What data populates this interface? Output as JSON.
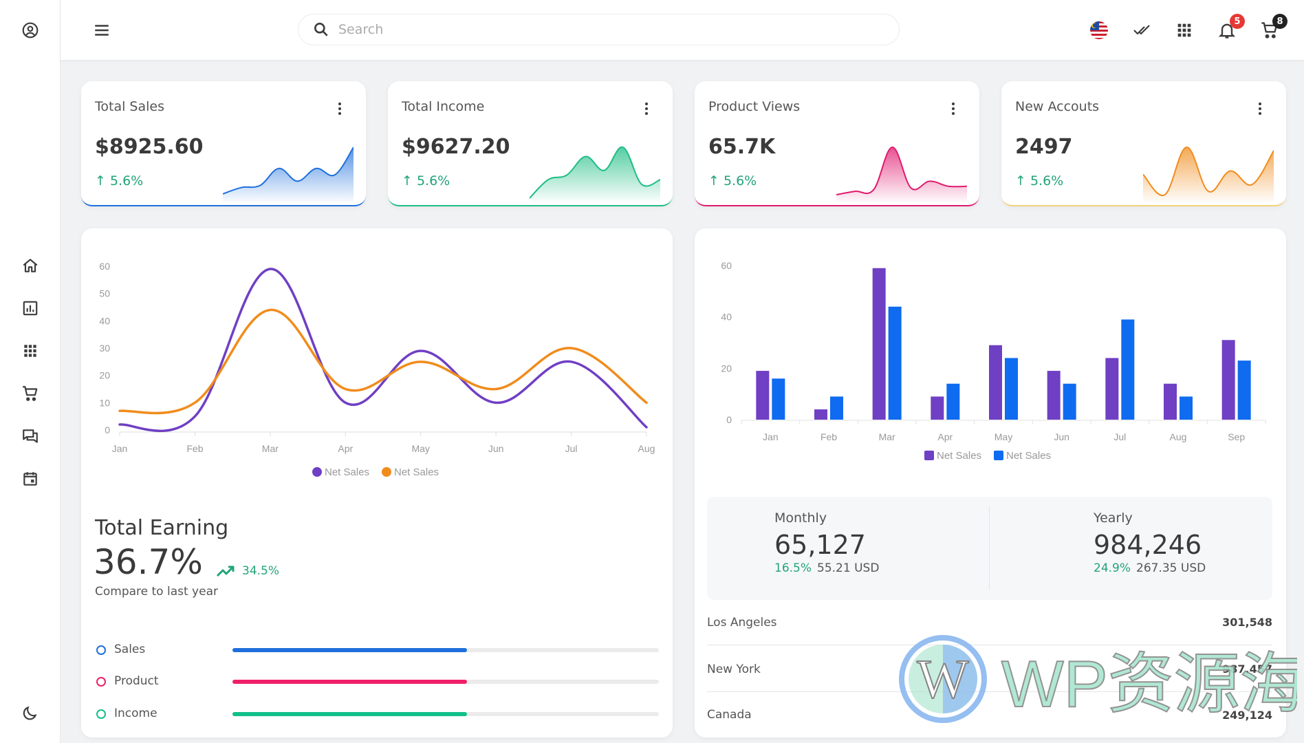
{
  "sidebar": {
    "items": [
      {
        "name": "profile",
        "icon": "user-circle-icon"
      },
      {
        "name": "home",
        "icon": "home-icon"
      },
      {
        "name": "analytics",
        "icon": "bar-chart-icon"
      },
      {
        "name": "apps",
        "icon": "grid-icon"
      },
      {
        "name": "shop",
        "icon": "cart-icon"
      },
      {
        "name": "chat",
        "icon": "chat-icon"
      },
      {
        "name": "calendar",
        "icon": "calendar-icon"
      },
      {
        "name": "theme",
        "icon": "moon-icon"
      }
    ]
  },
  "topbar": {
    "search_placeholder": "Search",
    "search_value": "",
    "icons": [
      "menu-icon",
      "search-icon",
      "flag-malaysia-icon",
      "double-check-icon",
      "apps-grid-icon",
      "bell-icon",
      "cart-icon"
    ],
    "notification_count": "5",
    "cart_count": "8",
    "colors": {
      "notification_badge": "#e53935",
      "cart_badge": "#222222"
    }
  },
  "stats": [
    {
      "title": "Total Sales",
      "value": "$8925.60",
      "change": "5.6%",
      "color": "#1e6fdc",
      "spark": [
        2,
        5,
        6,
        14,
        8,
        14,
        11,
        24
      ]
    },
    {
      "title": "Total Income",
      "value": "$9627.20",
      "change": "5.6%",
      "color": "#1dbd84",
      "spark": [
        0,
        8,
        10,
        18,
        12,
        22,
        6,
        8
      ]
    },
    {
      "title": "Product Views",
      "value": "65.7K",
      "change": "5.6%",
      "color": "#e0196e",
      "spark": [
        2,
        4,
        5,
        30,
        6,
        10,
        7,
        7
      ]
    },
    {
      "title": "New Accouts",
      "value": "2497",
      "change": "5.6%",
      "color": "#f08c1c",
      "spark": [
        14,
        2,
        30,
        4,
        16,
        8,
        28
      ]
    }
  ],
  "line_chart": {
    "total_earning_label": "Total Earning",
    "total_earning_value": "36.7%",
    "trend_value": "34.5%",
    "compare_label": "Compare to last year",
    "progress": [
      {
        "label": "Sales",
        "percent": 55,
        "color": "#1e6fdc"
      },
      {
        "label": "Product",
        "percent": 55,
        "color": "#ef1f69"
      },
      {
        "label": "Income",
        "percent": 55,
        "color": "#12c08a"
      }
    ]
  },
  "bar_panel": {
    "monthly_label": "Monthly",
    "monthly_value": "65,127",
    "monthly_pct": "16.5%",
    "monthly_usd": "55.21 USD",
    "yearly_label": "Yearly",
    "yearly_value": "984,246",
    "yearly_pct": "24.9%",
    "yearly_usd": "267.35 USD",
    "cities": [
      {
        "name": "Los Angeles",
        "value": "301,548"
      },
      {
        "name": "New York",
        "value": "987,457"
      },
      {
        "name": "Canada",
        "value": "249,124"
      }
    ]
  },
  "watermark": {
    "text": "WP资源海"
  },
  "chart_data": [
    {
      "type": "line",
      "title": "",
      "xlabel": "",
      "ylabel": "",
      "categories": [
        "Jan",
        "Feb",
        "Mar",
        "Apr",
        "May",
        "Jun",
        "Jul",
        "Aug"
      ],
      "series": [
        {
          "name": "Net Sales",
          "color": "#6f3fc4",
          "values": [
            2,
            5,
            59,
            10,
            29,
            10,
            25,
            1
          ]
        },
        {
          "name": "Net Sales",
          "color": "#f08c1c",
          "values": [
            7,
            10,
            44,
            15,
            25,
            15,
            30,
            10
          ]
        }
      ],
      "yticks": [
        0,
        10,
        20,
        30,
        40,
        50,
        60
      ],
      "ylim": [
        0,
        60
      ],
      "legend": "bottom",
      "grid": false
    },
    {
      "type": "bar",
      "title": "",
      "xlabel": "",
      "ylabel": "",
      "categories": [
        "Jan",
        "Feb",
        "Mar",
        "Apr",
        "May",
        "Jun",
        "Jul",
        "Aug",
        "Sep"
      ],
      "series": [
        {
          "name": "Net Sales",
          "color": "#6f3fc4",
          "values": [
            19,
            4,
            59,
            9,
            29,
            19,
            24,
            14,
            31
          ]
        },
        {
          "name": "Net Sales",
          "color": "#0f6bf0",
          "values": [
            16,
            9,
            44,
            14,
            24,
            14,
            39,
            9,
            23
          ]
        }
      ],
      "yticks": [
        0,
        20,
        40,
        60
      ],
      "ylim": [
        0,
        60
      ],
      "legend": "bottom",
      "grid": false
    }
  ]
}
